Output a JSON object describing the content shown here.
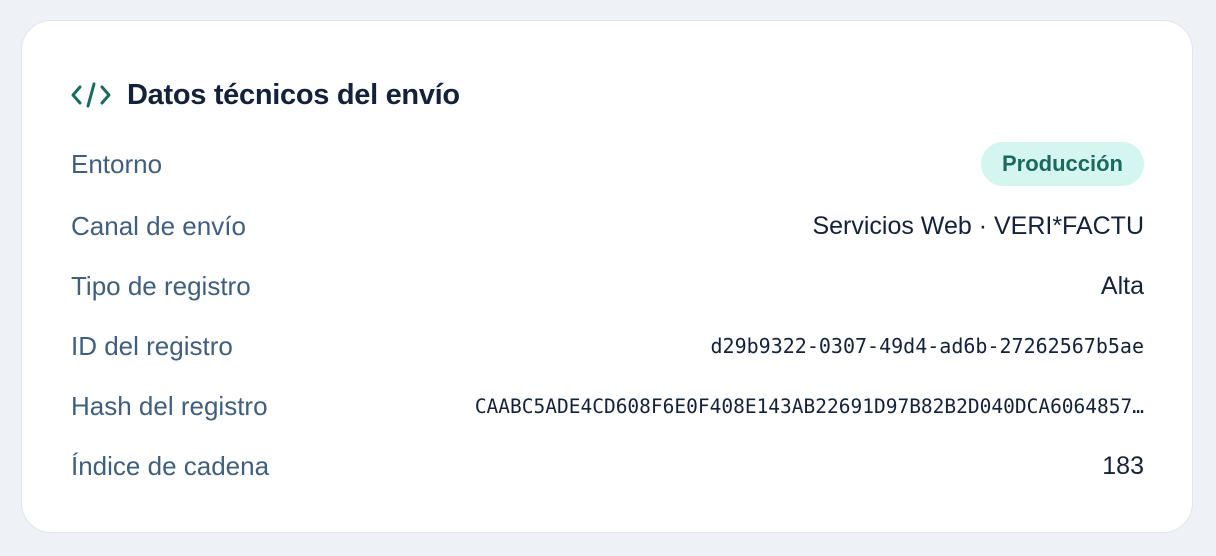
{
  "card": {
    "title": "Datos técnicos del envío",
    "icon": "code-icon",
    "accent_color": "#1b6a5f",
    "rows": [
      {
        "label": "Entorno",
        "value": "Producción",
        "style": "badge"
      },
      {
        "label": "Canal de envío",
        "value": "Servicios Web · VERI*FACTU"
      },
      {
        "label": "Tipo de registro",
        "value": "Alta"
      },
      {
        "label": "ID del registro",
        "value": "d29b9322-0307-49d4-ad6b-27262567b5ae"
      },
      {
        "label": "Hash del registro",
        "value": "CAABC5ADE4CD608F6E0F408E143AB22691D97B82B2D040DCA6064857…"
      },
      {
        "label": "Índice de cadena",
        "value": "183"
      }
    ]
  }
}
